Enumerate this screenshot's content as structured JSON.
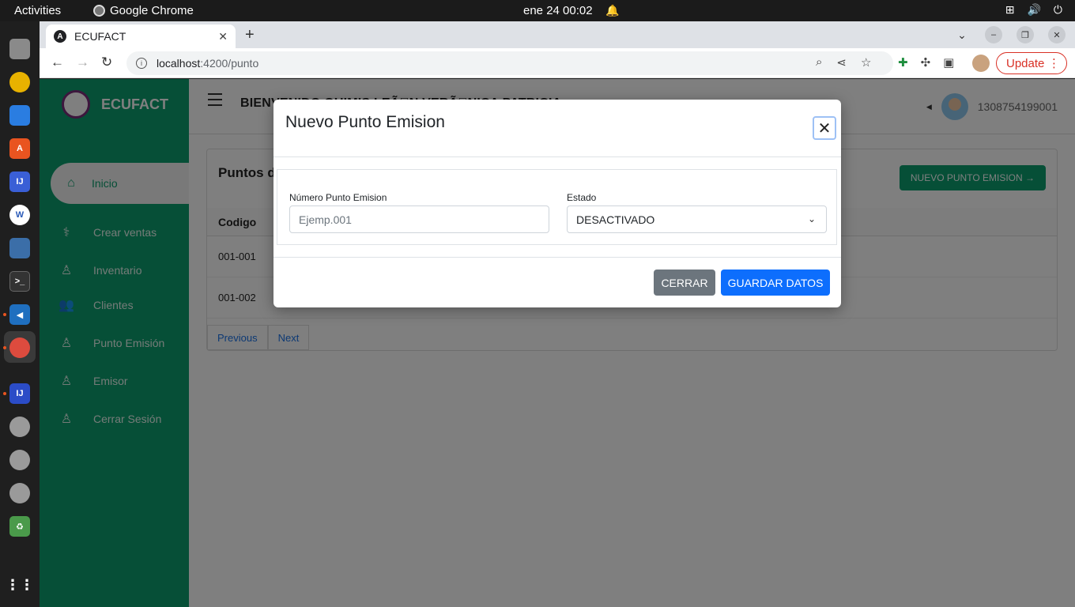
{
  "system": {
    "activities": "Activities",
    "app_name": "Google Chrome",
    "clock": "ene 24  00:02"
  },
  "browser": {
    "tab_title": "ECUFACT",
    "tab_favicon": "A",
    "url_host": "localhost",
    "url_path": ":4200/punto",
    "update_label": "Update"
  },
  "app": {
    "brand": "ECUFACT",
    "welcome": "BIENVENIDO QUIMIS LEÃ\u0000N VERÃ\u0000NICA PATRICIA",
    "user_id": "1308754199001",
    "menu": [
      {
        "label": "Inicio",
        "icon": "home-icon"
      },
      {
        "label": "Crear ventas",
        "icon": "stethoscope-icon"
      },
      {
        "label": "Inventario",
        "icon": "user-icon"
      },
      {
        "label": "Clientes",
        "icon": "users-icon"
      },
      {
        "label": "Punto Emisión",
        "icon": "user-doctor-icon"
      },
      {
        "label": "Emisor",
        "icon": "user-icon"
      },
      {
        "label": "Cerrar Sesión",
        "icon": "user-doctor-icon"
      }
    ],
    "card_title": "Puntos d",
    "new_button": "NUEVO PUNTO EMISION →",
    "table_header": "Codigo",
    "rows": [
      "001-001",
      "001-002"
    ],
    "pager": {
      "previous": "Previous",
      "next": "Next"
    }
  },
  "modal": {
    "title": "Nuevo Punto Emision",
    "numero_label": "Número Punto Emision",
    "numero_placeholder": "Ejemp.001",
    "estado_label": "Estado",
    "estado_value": "DESACTIVADO",
    "close_button": "CERRAR",
    "save_button": "GUARDAR DATOS"
  },
  "colors": {
    "sidebar": "#0c9e6e",
    "primary": "#0d6efd",
    "secondary": "#6c757d"
  }
}
